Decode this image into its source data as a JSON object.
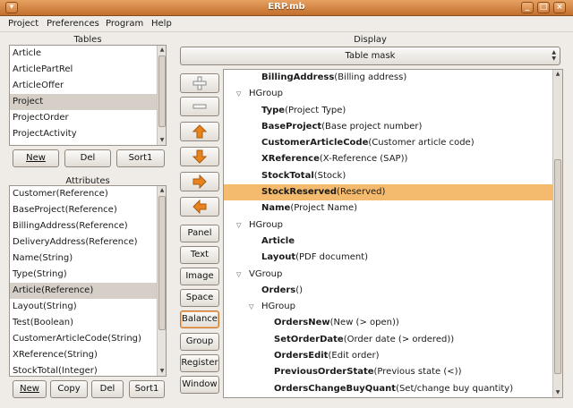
{
  "window": {
    "title": "ERP.mb",
    "minimize": "_",
    "maximize": "□",
    "close": "×"
  },
  "menu": [
    "Project",
    "Preferences",
    "Program",
    "Help"
  ],
  "tables": {
    "label": "Tables",
    "items": [
      "Article",
      "ArticlePartRel",
      "ArticleOffer",
      "Project",
      "ProjectOrder",
      "ProjectActivity"
    ],
    "selected_index": 3,
    "buttons": {
      "new": "New",
      "del": "Del",
      "sort": "Sort1"
    }
  },
  "attributes": {
    "label": "Attributes",
    "items": [
      "Customer(Reference)",
      "BaseProject(Reference)",
      "BillingAddress(Reference)",
      "DeliveryAddress(Reference)",
      "Name(String)",
      "Type(String)",
      "Article(Reference)",
      "Layout(String)",
      "Test(Boolean)",
      "CustomerArticleCode(String)",
      "XReference(String)",
      "StockTotal(Integer)"
    ],
    "selected_index": 6,
    "buttons": {
      "new": "New",
      "copy": "Copy",
      "del": "Del",
      "sort": "Sort1"
    }
  },
  "display": {
    "label": "Display",
    "mask_select": "Table mask",
    "tool_buttons": [
      "Panel",
      "Text",
      "Image",
      "Space",
      "Balance",
      "Group",
      "Register",
      "Window"
    ],
    "active_tool": "Balance"
  },
  "tree": [
    {
      "indent": 0,
      "expander": false,
      "bold": "BillingAddress",
      "rest": "(Billing address)"
    },
    {
      "indent": 0,
      "expander": true,
      "bold": "",
      "rest": "HGroup"
    },
    {
      "indent": 0,
      "expander": false,
      "bold": "Type",
      "rest": "(Project Type)"
    },
    {
      "indent": 0,
      "expander": false,
      "bold": "BaseProject",
      "rest": "(Base project number)"
    },
    {
      "indent": 0,
      "expander": false,
      "bold": "CustomerArticleCode",
      "rest": "(Customer article code)"
    },
    {
      "indent": 0,
      "expander": false,
      "bold": "XReference",
      "rest": "(X-Reference (SAP))"
    },
    {
      "indent": 0,
      "expander": false,
      "bold": "StockTotal",
      "rest": "(Stock)"
    },
    {
      "indent": 0,
      "expander": false,
      "bold": "StockReserved",
      "rest": "(Reserved)",
      "selected": true
    },
    {
      "indent": 0,
      "expander": false,
      "bold": "Name",
      "rest": "(Project Name)"
    },
    {
      "indent": 0,
      "expander": true,
      "bold": "",
      "rest": "HGroup"
    },
    {
      "indent": 0,
      "expander": false,
      "bold": "Article",
      "rest": ""
    },
    {
      "indent": 0,
      "expander": false,
      "bold": "Layout",
      "rest": "(PDF document)"
    },
    {
      "indent": 0,
      "expander": true,
      "bold": "",
      "rest": "VGroup"
    },
    {
      "indent": 0,
      "expander": false,
      "bold": "Orders",
      "rest": "()"
    },
    {
      "indent": 1,
      "expander": true,
      "bold": "",
      "rest": "HGroup"
    },
    {
      "indent": 1,
      "expander": false,
      "bold": "OrdersNew",
      "rest": "(New (> open))"
    },
    {
      "indent": 1,
      "expander": false,
      "bold": "SetOrderDate",
      "rest": "(Order date (> ordered))"
    },
    {
      "indent": 1,
      "expander": false,
      "bold": "OrdersEdit",
      "rest": "(Edit order)"
    },
    {
      "indent": 1,
      "expander": false,
      "bold": "PreviousOrderState",
      "rest": "(Previous state (<))"
    },
    {
      "indent": 1,
      "expander": false,
      "bold": "OrdersChangeBuyQuant",
      "rest": "(Set/change buy quantity)"
    }
  ],
  "icons": {
    "add": "plus-icon",
    "remove": "minus-icon",
    "up": "arrow-up-icon",
    "down": "arrow-down-icon",
    "right": "arrow-right-icon",
    "left": "arrow-left-icon"
  },
  "colors": {
    "title": "#c97a37",
    "selection": "#f4bb6e",
    "arrow": "#e8841e"
  }
}
